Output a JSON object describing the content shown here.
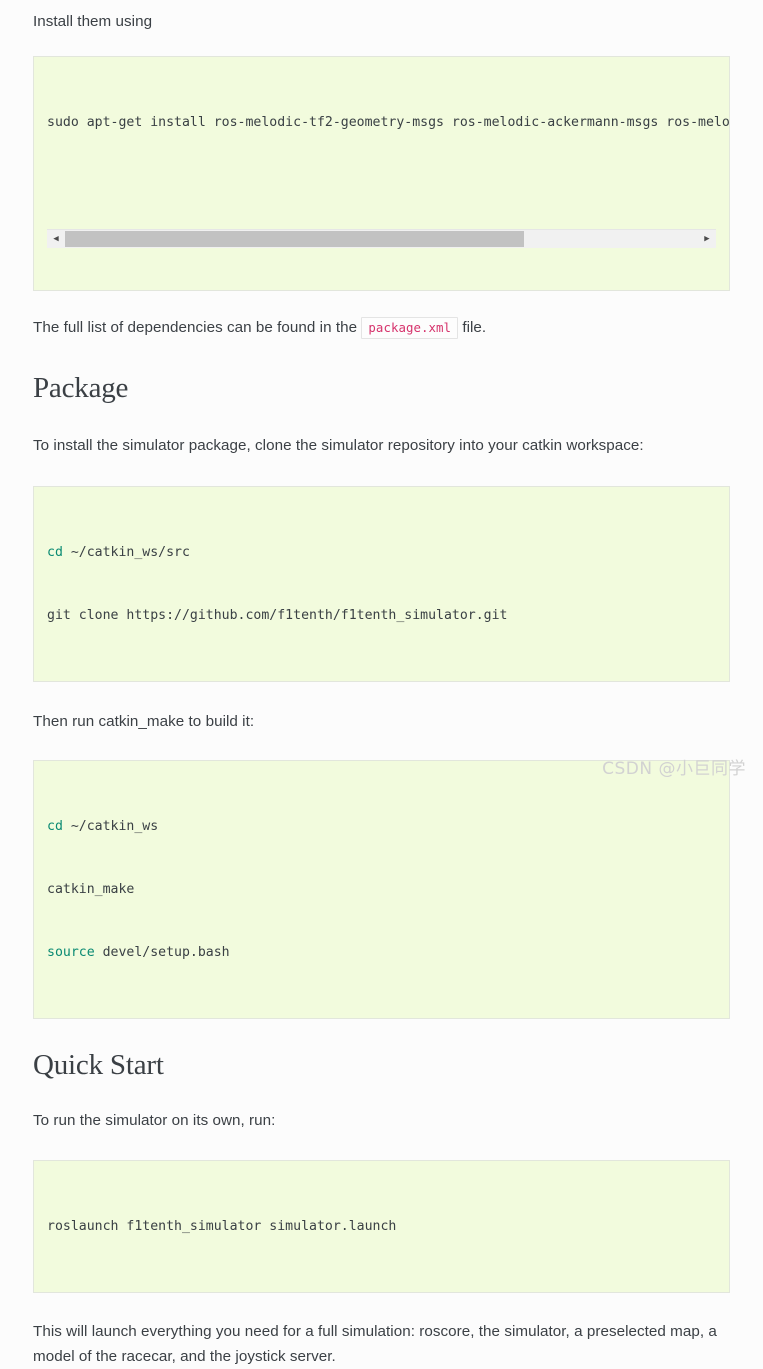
{
  "document": {
    "intro_paragraph": "Install them using",
    "dependency_note_before": "The full list of dependencies can be found in the",
    "dependency_inline_code": "package.xml",
    "dependency_note_after": "file.",
    "package_heading": "Package",
    "package_paragraph": "To install the simulator package, clone the simulator repository into your catkin workspace:",
    "catkin_make_paragraph": "Then run catkin_make to build it:",
    "quickstart_heading": "Quick Start",
    "quickstart_paragraph": "To run the simulator on its own, run:",
    "launch_paragraph": "This will launch everything you need for a full simulation: roscore, the simulator, a preselected map, a model of the racecar, and the joystick server."
  },
  "code_blocks": {
    "apt_install": {
      "visible_text": "sudo apt-get install ros-melodic-tf2-geometry-msgs ros-melodic-ackermann-msgs ros-melodic",
      "scrollbar": {
        "left_arrow": "◀",
        "right_arrow": "▶",
        "thumb_width_percent": "72.5"
      }
    },
    "clone": {
      "line1_builtin": "cd",
      "line1_rest": " ~/catkin_ws/src",
      "line2": "git clone https://github.com/f1tenth/f1tenth_simulator.git"
    },
    "build": {
      "line1_builtin": "cd",
      "line1_rest": " ~/catkin_ws",
      "line2": "catkin_make",
      "line3_builtin": "source",
      "line3_rest": " devel/setup.bash"
    },
    "roslaunch": {
      "line1": "roslaunch f1tenth_simulator simulator.launch"
    }
  },
  "watermark": {
    "text": "CSDN @小巨同学"
  },
  "colors": {
    "code_background": "#f2fbdd",
    "code_border": "#e2e6dc",
    "inline_code_text": "#d6336c",
    "builtin_keyword": "#0a8a72",
    "body_text": "#3b4045",
    "page_background": "#fcfcfc",
    "scrollbar_thumb": "#c2c2c2",
    "watermark_text": "#d2d2d2"
  }
}
